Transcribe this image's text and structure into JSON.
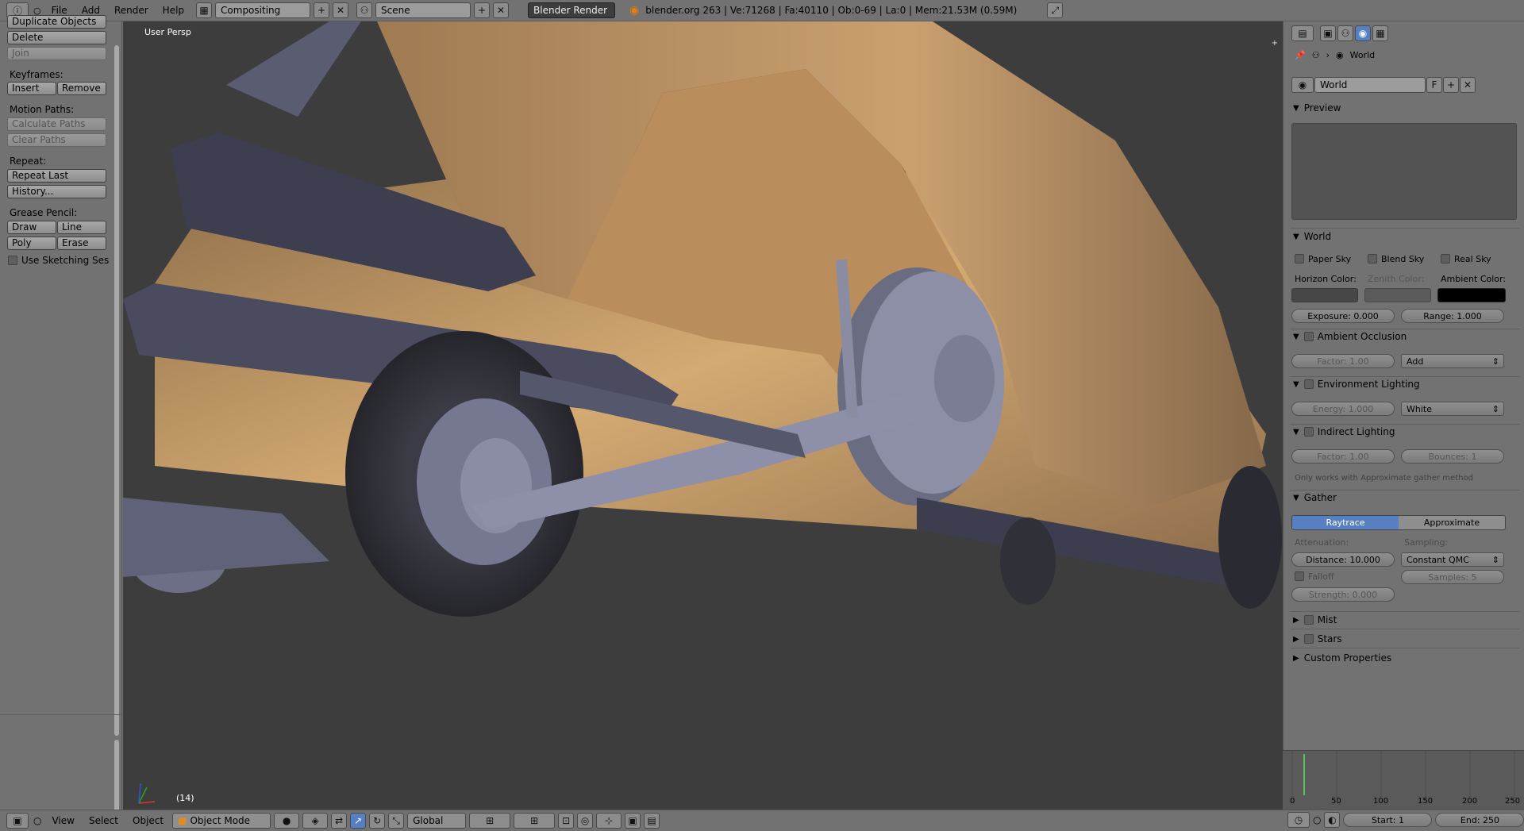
{
  "menu": {
    "file": "File",
    "add": "Add",
    "render": "Render",
    "help": "Help"
  },
  "header": {
    "layout": "Compositing",
    "scene": "Scene",
    "engine": "Blender Render",
    "stats": "blender.org 263 | Ve:71268 | Fa:40110 | Ob:0-69 | La:0 | Mem:21.53M (0.59M)"
  },
  "tools": {
    "duplicate": "Duplicate Objects",
    "delete": "Delete",
    "join": "Join",
    "keyframes": "Keyframes:",
    "insert": "Insert",
    "remove": "Remove",
    "motion_paths": "Motion Paths:",
    "calculate_paths": "Calculate Paths",
    "clear_paths": "Clear Paths",
    "repeat": "Repeat:",
    "repeat_last": "Repeat Last",
    "history": "History...",
    "grease_pencil": "Grease Pencil:",
    "draw": "Draw",
    "line": "Line",
    "poly": "Poly",
    "erase": "Erase",
    "use_sketching": "Use Sketching Sessio"
  },
  "viewport": {
    "label": "User Persp",
    "frame": "(14)"
  },
  "properties": {
    "breadcrumb": "World",
    "world_name": "World",
    "fake_user": "F",
    "preview": "Preview",
    "world_panel": "World",
    "paper_sky": "Paper Sky",
    "blend_sky": "Blend Sky",
    "real_sky": "Real Sky",
    "horizon_color": "Horizon Color:",
    "zenith_color": "Zenith Color:",
    "ambient_color": "Ambient Color:",
    "exposure": "Exposure: 0.000",
    "range": "Range: 1.000",
    "ao": "Ambient Occlusion",
    "ao_factor": "Factor: 1.00",
    "ao_blend": "Add",
    "env": "Environment Lighting",
    "env_energy": "Energy: 1.000",
    "env_color": "White",
    "indirect": "Indirect Lighting",
    "ind_factor": "Factor: 1.00",
    "ind_bounces": "Bounces: 1",
    "ind_note": "Only works with Approximate gather method",
    "gather": "Gather",
    "raytrace": "Raytrace",
    "approximate": "Approximate",
    "attenuation": "Attenuation:",
    "sampling": "Sampling:",
    "distance": "Distance: 10.000",
    "sampling_method": "Constant QMC",
    "falloff": "Falloff",
    "samples": "Samples: 5",
    "strength": "Strength: 0.000",
    "mist": "Mist",
    "stars": "Stars",
    "custom": "Custom Properties"
  },
  "timeline": {
    "ticks": [
      "0",
      "50",
      "100",
      "150",
      "200",
      "250"
    ],
    "start": "Start: 1",
    "end": "End: 250"
  },
  "bottom": {
    "view": "View",
    "select": "Select",
    "object": "Object",
    "mode": "Object Mode",
    "orientation": "Global"
  },
  "colors": {
    "accent": "#5680c2",
    "current_frame": "#5ac35a",
    "car_body": "#c9a06a"
  }
}
